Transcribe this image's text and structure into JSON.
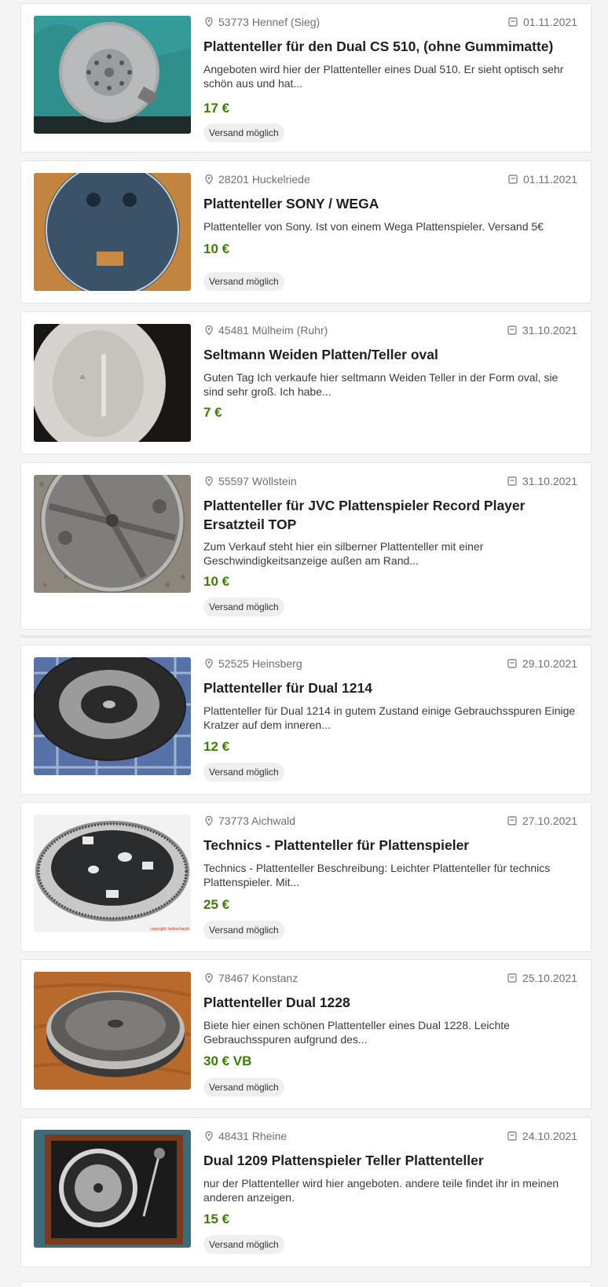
{
  "listings": [
    {
      "location": "53773 Hennef (Sieg)",
      "date": "01.11.2021",
      "title": "Plattenteller für den Dual CS 510, (ohne Gummimatte)",
      "description": "Angeboten wird hier der Plattenteller eines Dual 510. Er sieht optisch sehr schön aus und hat...",
      "price": "17 €",
      "badge": "Versand möglich",
      "image": "platter-on-teal-cloth"
    },
    {
      "location": "28201 Huckelriede",
      "date": "01.11.2021",
      "title": "Plattenteller SONY / WEGA",
      "description": "Plattenteller von Sony. Ist von einem Wega Plattenspieler. Versand 5€",
      "price": "10 €",
      "badge": "Versand möglich",
      "image": "dark-platter-on-wood"
    },
    {
      "location": "45481 Mülheim (Ruhr)",
      "date": "31.10.2021",
      "title": "Seltmann Weiden Platten/Teller oval",
      "description": "Guten Tag Ich verkaufe hier seltmann Weiden Teller in der Form oval, sie sind sehr groß. Ich habe...",
      "price": "7 €",
      "badge": "",
      "image": "oval-porcelain-plate"
    },
    {
      "location": "55597 Wöllstein",
      "date": "31.10.2021",
      "title": "Plattenteller für JVC Plattenspieler Record Player Ersatzteil TOP",
      "description": "Zum Verkauf steht hier ein silberner Plattenteller mit einer Geschwindigkeitsanzeige außen am Rand...",
      "price": "10 €",
      "badge": "Versand möglich",
      "image": "silver-platter-on-granite"
    },
    {
      "location": "52525 Heinsberg",
      "date": "29.10.2021",
      "title": "Plattenteller für Dual 1214",
      "description": "Plattenteller für Dual 1214 in gutem Zustand einige Gebrauchsspuren Einige Kratzer auf dem inneren...",
      "price": "12 €",
      "badge": "Versand möglich",
      "image": "black-platter-on-tablecloth"
    },
    {
      "location": "73773 Aichwald",
      "date": "27.10.2021",
      "title": "Technics - Plattenteller für Plattenspieler",
      "description": "Technics - Plattenteller Beschreibung: Leichter Plattenteller für technics Plattenspieler. Mit...",
      "price": "25 €",
      "badge": "Versand möglich",
      "image": "technics-platter-white-bg",
      "watermark": "copyright: bideschaubi"
    },
    {
      "location": "78467 Konstanz",
      "date": "25.10.2021",
      "title": "Plattenteller Dual 1228",
      "description": "Biete hier einen schönen Plattenteller eines Dual 1228. Leichte Gebrauchsspuren aufgrund des...",
      "price": "30 € VB",
      "badge": "Versand möglich",
      "image": "platter-on-wood-table"
    },
    {
      "location": "48431 Rheine",
      "date": "24.10.2021",
      "title": "Dual 1209 Plattenspieler Teller Plattenteller",
      "description": "nur der Plattenteller wird hier angeboten. andere teile findet ihr in meinen anderen anzeigen.",
      "price": "15 €",
      "badge": "Versand möglich",
      "image": "turntable-in-wood-case"
    }
  ],
  "colors": {
    "price": "#3c7f00",
    "title": "#1e1e1e",
    "meta": "#6f6f6f",
    "badge_bg": "#efefef",
    "page_bg": "#f4f4f4"
  },
  "icons": {
    "location": "map-pin-icon",
    "date": "calendar-icon"
  }
}
